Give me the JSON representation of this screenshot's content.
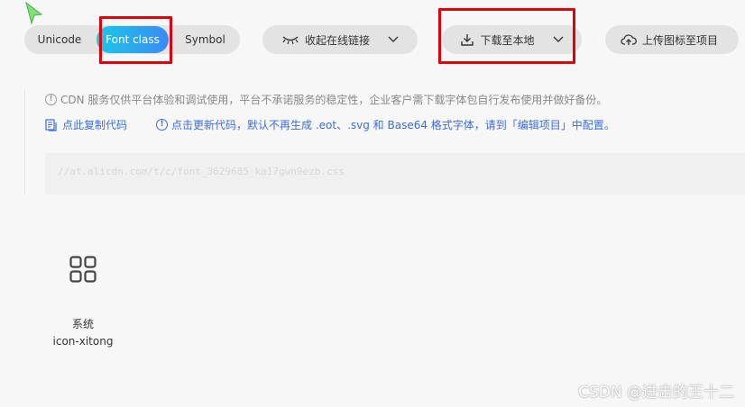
{
  "tabs": [
    {
      "label": "Unicode"
    },
    {
      "label": "Font class"
    },
    {
      "label": "Symbol"
    }
  ],
  "toolbar": {
    "collect_label": "收起在线链接",
    "download_label": "下载至本地",
    "upload_label": "上传图标至项目"
  },
  "notice": {
    "text": "CDN 服务仅供平台体验和调试使用，平台不承诺服务的稳定性，企业客户需下载字体包自行发布使用并做好备份。"
  },
  "actions": {
    "copy_label": "点此复制代码",
    "update_label": "点击更新代码，默认不再生成 .eot、.svg 和 Base64 格式字体，请到「编辑项目」中配置。"
  },
  "code": {
    "url": "//at.alicdn.com/t/c/font_3629685_ka17gwn9ezb.css"
  },
  "icons": [
    {
      "name": "系统",
      "class": "icon-xitong",
      "icon": "grid-icon"
    }
  ],
  "watermark": "CSDN @进击的王十二",
  "colors": {
    "accent_start": "#19c8e8",
    "accent_end": "#3b8bf5",
    "link": "#3b6ce0",
    "highlight": "#e0000b"
  }
}
